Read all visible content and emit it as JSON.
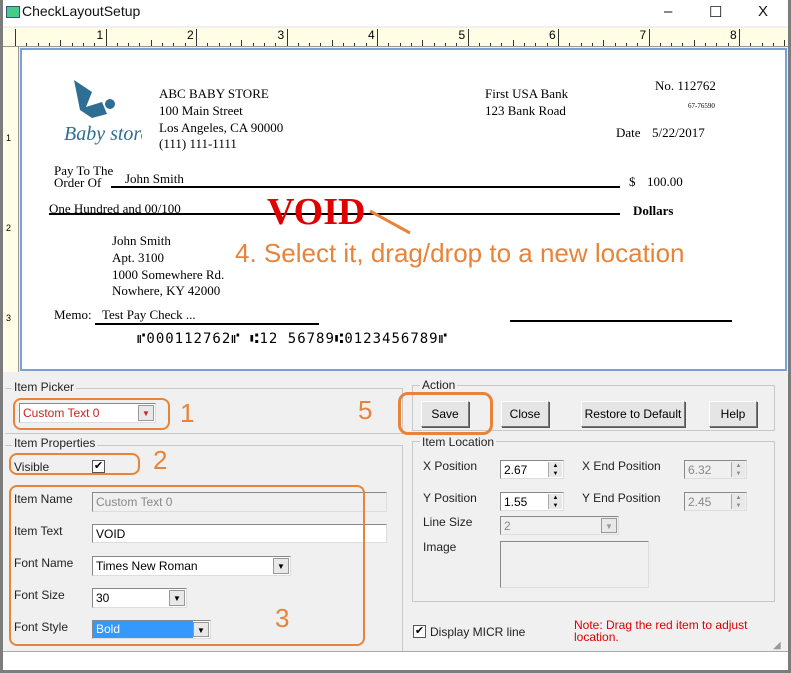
{
  "window": {
    "title": "CheckLayoutSetup",
    "minimize": "–",
    "maximize": "☐",
    "close": "X"
  },
  "ruler": {
    "ticks": [
      "1",
      "2",
      "3",
      "4",
      "5",
      "6",
      "7",
      "8"
    ],
    "vticks": [
      "1",
      "2",
      "3"
    ]
  },
  "check": {
    "company": [
      "ABC BABY STORE",
      "100 Main Street",
      "Los Angeles, CA 90000",
      "(111) 111-1111"
    ],
    "logo_text": "Baby store",
    "bank": [
      "First USA Bank",
      "123 Bank Road"
    ],
    "check_no": "No. 112762",
    "routing_fraction": "67-76590",
    "date_label": "Date",
    "date": "5/22/2017",
    "pay_to_label_1": "Pay To The",
    "pay_to_label_2": "Order Of",
    "payee": "John Smith",
    "dollar_sign": "$",
    "amount": "100.00",
    "amount_words": "One Hundred  and 00/100",
    "dollars_label": "Dollars",
    "void_text": "VOID",
    "address": [
      "John Smith",
      "Apt. 3100",
      "1000 Somewhere Rd.",
      "Nowhere, KY 42000"
    ],
    "memo_label": "Memo:",
    "memo": "Test Pay Check ...",
    "micr": "⑈000112762⑈ ⑆12 56789⑆0123456789⑈"
  },
  "annotations": {
    "step1": "1",
    "step2": "2",
    "step3": "3",
    "step4": "4. Select it, drag/drop to a new location",
    "step5": "5"
  },
  "item_picker": {
    "title": "Item Picker",
    "selected": "Custom Text 0"
  },
  "item_properties": {
    "title": "Item Properties",
    "visible_label": "Visible",
    "visible": true,
    "item_name_label": "Item Name",
    "item_name": "Custom Text 0",
    "item_text_label": "Item Text",
    "item_text": "VOID",
    "font_name_label": "Font Name",
    "font_name": "Times New Roman",
    "font_size_label": "Font Size",
    "font_size": "30",
    "font_style_label": "Font Style",
    "font_style": "Bold"
  },
  "action": {
    "title": "Action",
    "save": "Save",
    "close": "Close",
    "restore": "Restore to Default",
    "help": "Help"
  },
  "item_location": {
    "title": "Item Location",
    "x_label": "X Position",
    "x": "2.67",
    "x_end_label": "X End Position",
    "x_end": "6.32",
    "y_label": "Y Position",
    "y": "1.55",
    "y_end_label": "Y End Position",
    "y_end": "2.45",
    "line_size_label": "Line Size",
    "line_size": "2",
    "image_label": "Image"
  },
  "micr_option": {
    "label": "Display MICR line",
    "checked": true
  },
  "note": "Note:  Drag the red item to adjust location.",
  "colors": {
    "annotation": "#e8833a",
    "void": "#e00000",
    "note": "#e00000",
    "selection": "#3399ff"
  }
}
